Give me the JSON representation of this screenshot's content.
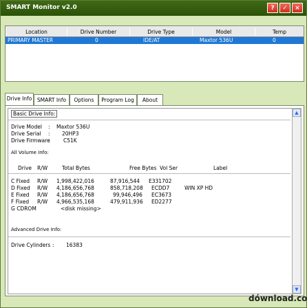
{
  "window": {
    "title": "SMART Monitor v2.0",
    "buttons": [
      "?",
      "✓",
      "×"
    ]
  },
  "drive_table": {
    "headers": [
      "Location",
      "Drive Number",
      "Drive Type",
      "Model",
      "Temp"
    ],
    "selected_row": {
      "location": "PRIMARY MASTER",
      "drive_number": "0",
      "drive_type": "IDE/AT",
      "model": "Maxtor 536U",
      "temp": "0"
    }
  },
  "tabs": [
    "Drive Info",
    "SMART Info",
    "Options",
    "Program Log",
    "About"
  ],
  "drive_info": {
    "basic_title": "Basic Drive Info:",
    "model_label": "Drive Model",
    "model_value": "Maxtor 536U",
    "serial_label": "Drive Serial",
    "serial_value": "20HP3",
    "firmware_label": "Drive Firmware",
    "firmware_value": "C51K",
    "volume_title": "All Volume Info:",
    "volume_headers": [
      "Drive",
      "R/W",
      "Total Bytes",
      "Free Bytes",
      "Vol Ser",
      "Label"
    ],
    "volumes": [
      {
        "drive": "C Fixed",
        "rw": "R/W",
        "total": "1,998,422,016",
        "free": "87,916,544",
        "ser": "E331702",
        "label": ""
      },
      {
        "drive": "D Fixed",
        "rw": "R/W",
        "total": "4,186,656,768",
        "free": "858,718,208",
        "ser": "ECDD7",
        "label": "WIN XP HD"
      },
      {
        "drive": "E Fixed",
        "rw": "R/W",
        "total": "4,186,656,768",
        "free": "99,946,496",
        "ser": "EC3673",
        "label": ""
      },
      {
        "drive": "F Fixed",
        "rw": "R/W",
        "total": "4,966,535,168",
        "free": "479,911,936",
        "ser": "ED2277",
        "label": ""
      },
      {
        "drive": "G CDROM",
        "rw": "",
        "total": "<disk missing>",
        "free": "",
        "ser": "",
        "label": ""
      }
    ],
    "advanced_title": "Advanced Drive Info:",
    "cylinders_label": "Drive Cylinders",
    "cylinders_value": "16383"
  },
  "watermark": "dównload.com"
}
